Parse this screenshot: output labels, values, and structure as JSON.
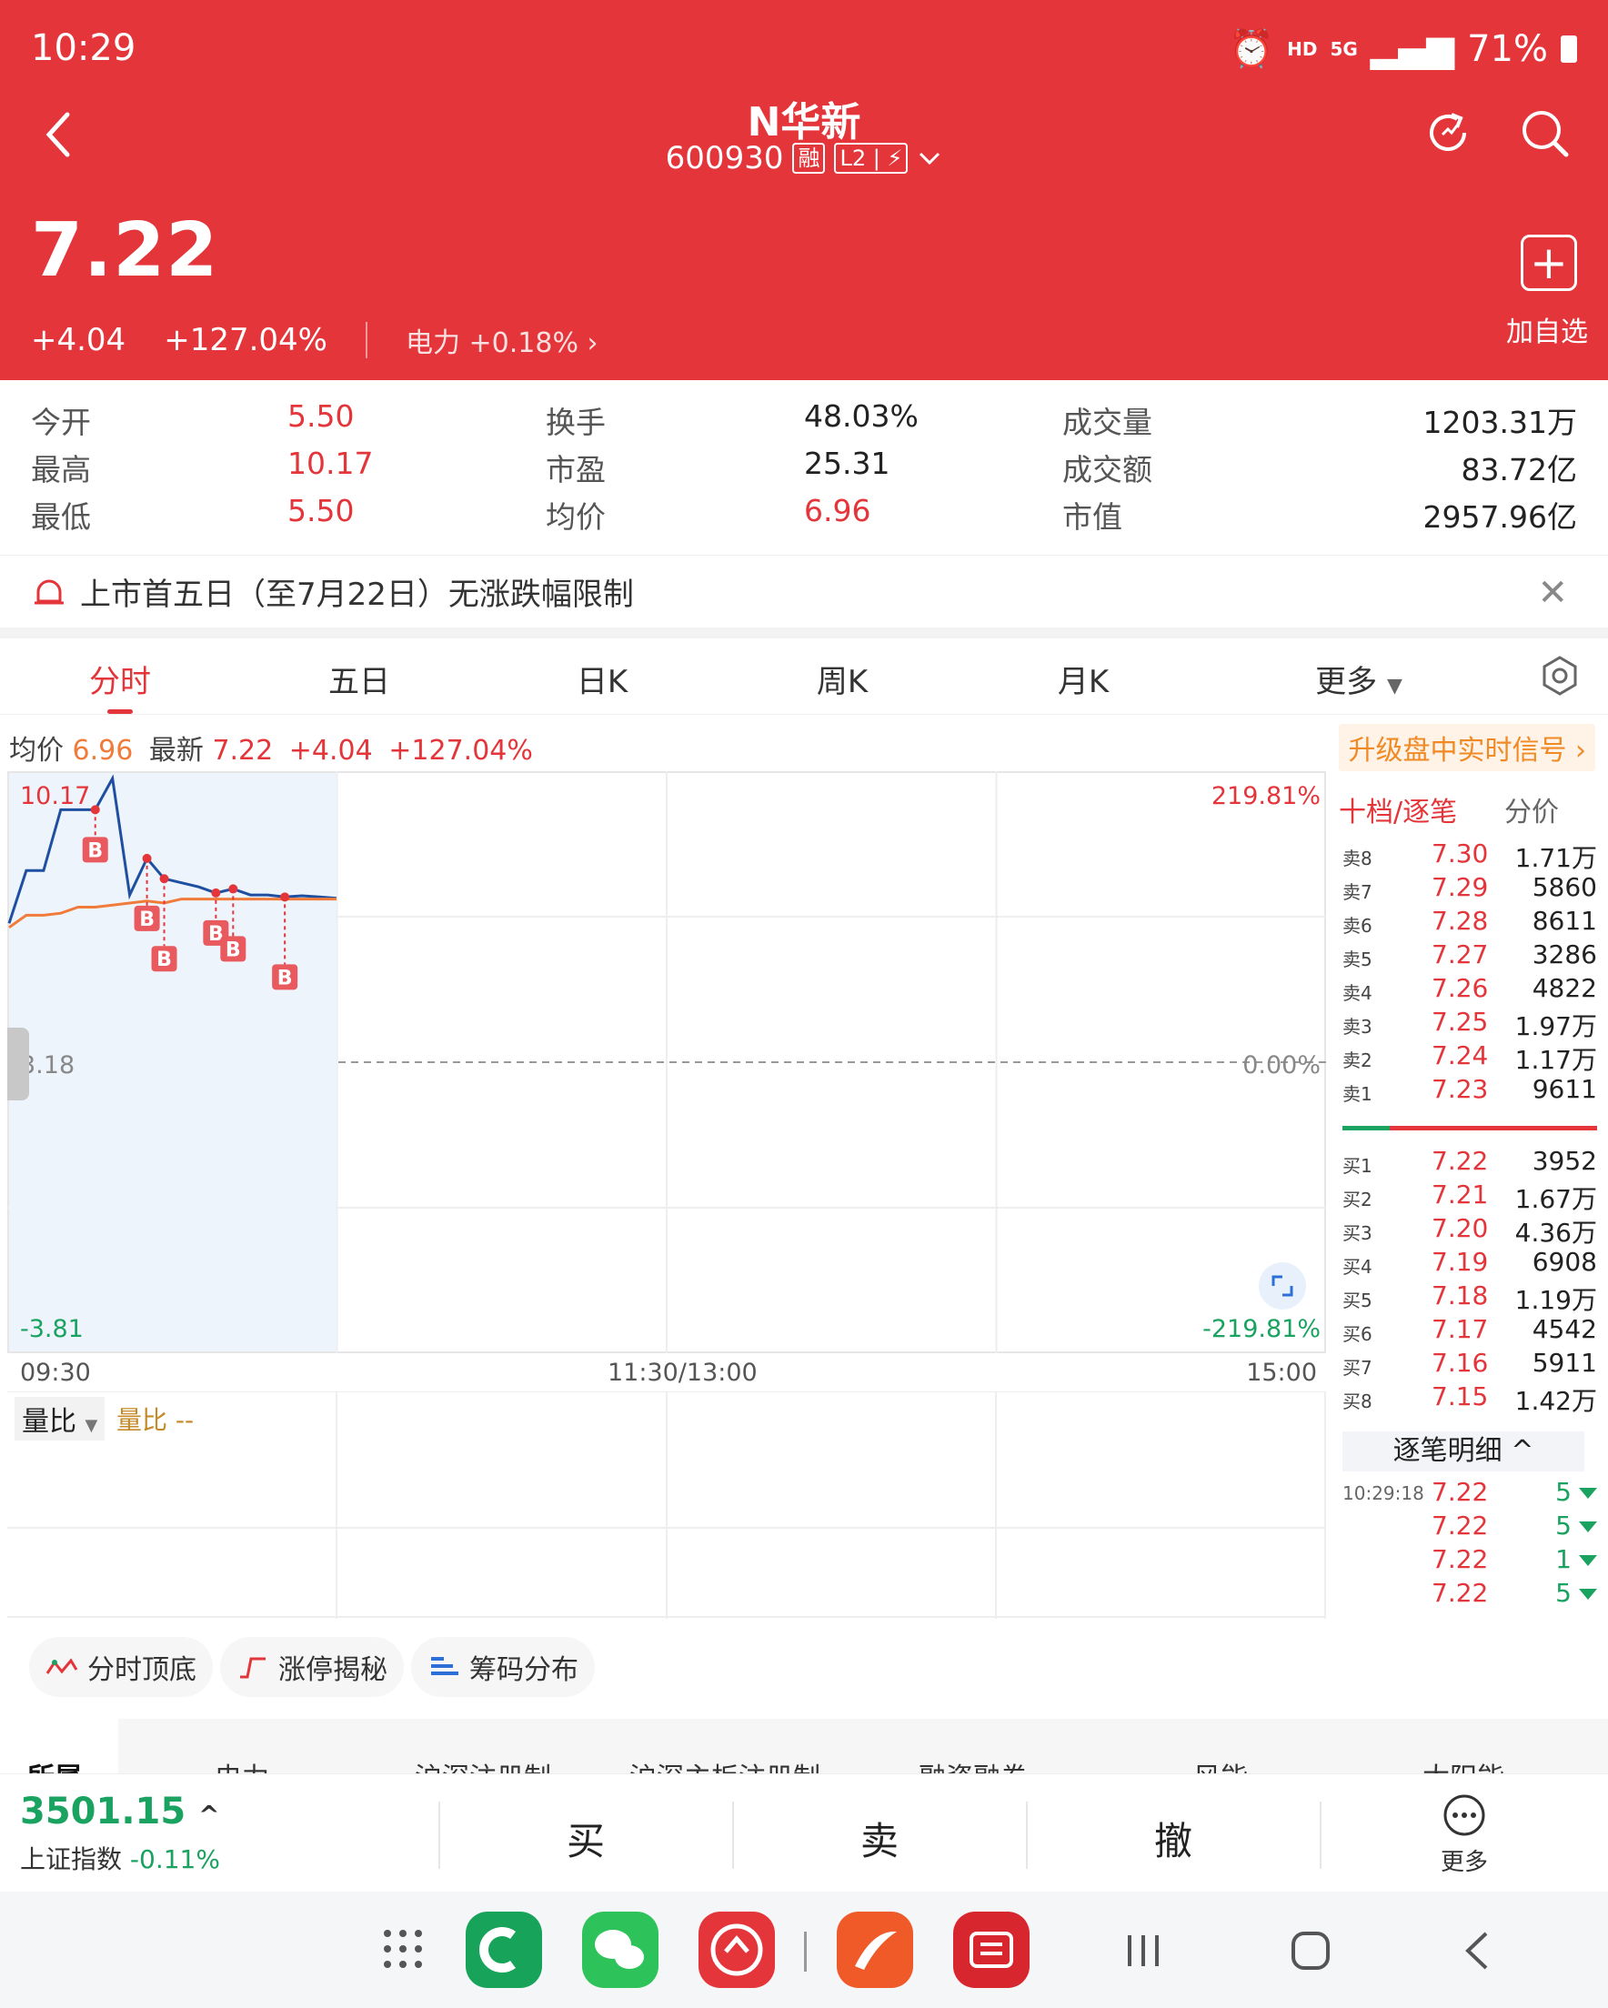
{
  "status_bar": {
    "time": "10:29",
    "hd": "HD",
    "net": "5G",
    "battery": "71%"
  },
  "header": {
    "back_icon": "chevron-left-icon",
    "title": "N华新",
    "code": "600930",
    "margin_tag": "融",
    "level_tag": "L2",
    "dropdown_icon": "chevron-down-icon",
    "refresh_icon": "refresh-icon",
    "search_icon": "search-icon",
    "price": "7.22",
    "change": "+4.04",
    "change_pct": "+127.04%",
    "sector": "电力 +0.18%",
    "add_label": "加自选"
  },
  "stats": {
    "open_label": "今开",
    "open": "5.50",
    "high_label": "最高",
    "high": "10.17",
    "low_label": "最低",
    "low": "5.50",
    "turnover_label": "换手",
    "turnover": "48.03%",
    "pe_label": "市盈",
    "pe": "25.31",
    "avg_label": "均价",
    "avg": "6.96",
    "vol_label": "成交量",
    "vol": "1203.31万",
    "amt_label": "成交额",
    "amt": "83.72亿",
    "mcap_label": "市值",
    "mcap": "2957.96亿"
  },
  "notice": {
    "text": "上市首五日（至7月22日）无涨跌幅限制",
    "close": "✕"
  },
  "tabs": [
    "分时",
    "五日",
    "日K",
    "周K",
    "月K",
    "更多"
  ],
  "chart_info": {
    "avg_label": "均价",
    "avg": "6.96",
    "latest_label": "最新",
    "latest": "7.22",
    "chg": "+4.04",
    "pct": "+127.04%",
    "upgrade": "升级盘中实时信号 ›"
  },
  "chart_data": {
    "type": "line",
    "y_top_label": "10.17",
    "y_mid_label": "3.18",
    "y_bottom_label": "-3.81",
    "pct_top": "219.81%",
    "pct_mid": "0.00%",
    "pct_bottom": "-219.81%",
    "x_labels": [
      "09:30",
      "11:30/13:00",
      "15:00"
    ],
    "ylim": [
      -3.81,
      10.17
    ],
    "series": [
      {
        "color": "#1f4fa0",
        "values": [
          6.6,
          7.9,
          7.9,
          9.4,
          9.4,
          9.4,
          10.17,
          7.3,
          8.2,
          7.7,
          7.6,
          7.5,
          7.35,
          7.45,
          7.3,
          7.3,
          7.25,
          7.28,
          7.25,
          7.22
        ]
      },
      {
        "color": "#f07b3a",
        "values": [
          6.5,
          6.8,
          6.8,
          6.85,
          7.0,
          7.0,
          7.05,
          7.1,
          7.15,
          7.1,
          7.2,
          7.2,
          7.2,
          7.2,
          7.2,
          7.2,
          7.2,
          7.2,
          7.2,
          7.2
        ]
      }
    ],
    "markers": [
      {
        "i": 5,
        "label": "B"
      },
      {
        "i": 8,
        "label": "B"
      },
      {
        "i": 9,
        "label": "B"
      },
      {
        "i": 12,
        "label": "B"
      },
      {
        "i": 13,
        "label": "B"
      },
      {
        "i": 16,
        "label": "B"
      }
    ],
    "volume_label": "量比",
    "volume_value": "量比 --"
  },
  "orderbook": {
    "header": "十档/逐笔",
    "header2": "分价",
    "asks": [
      {
        "lv": "卖8",
        "p": "7.30",
        "v": "1.71万"
      },
      {
        "lv": "卖7",
        "p": "7.29",
        "v": "5860"
      },
      {
        "lv": "卖6",
        "p": "7.28",
        "v": "8611"
      },
      {
        "lv": "卖5",
        "p": "7.27",
        "v": "3286"
      },
      {
        "lv": "卖4",
        "p": "7.26",
        "v": "4822"
      },
      {
        "lv": "卖3",
        "p": "7.25",
        "v": "1.97万"
      },
      {
        "lv": "卖2",
        "p": "7.24",
        "v": "1.17万"
      },
      {
        "lv": "卖1",
        "p": "7.23",
        "v": "9611"
      }
    ],
    "bids": [
      {
        "lv": "买1",
        "p": "7.22",
        "v": "3952"
      },
      {
        "lv": "买2",
        "p": "7.21",
        "v": "1.67万"
      },
      {
        "lv": "买3",
        "p": "7.20",
        "v": "4.36万"
      },
      {
        "lv": "买4",
        "p": "7.19",
        "v": "6908"
      },
      {
        "lv": "买5",
        "p": "7.18",
        "v": "1.19万"
      },
      {
        "lv": "买6",
        "p": "7.17",
        "v": "4542"
      },
      {
        "lv": "买7",
        "p": "7.16",
        "v": "5911"
      },
      {
        "lv": "买8",
        "p": "7.15",
        "v": "1.42万"
      }
    ],
    "tick_header": "逐笔明细 ^",
    "ticks": [
      {
        "t": "10:29:18",
        "p": "7.22",
        "v": "5"
      },
      {
        "t": "",
        "p": "7.22",
        "v": "5"
      },
      {
        "t": "",
        "p": "7.22",
        "v": "1"
      },
      {
        "t": "",
        "p": "7.22",
        "v": "5"
      }
    ]
  },
  "tools": [
    "分时顶底",
    "涨停揭秘",
    "筹码分布"
  ],
  "concepts": [
    "所属",
    "电力",
    "沪深注册制",
    "沪深主板注册制",
    "融资融券",
    "风能",
    "太阳能"
  ],
  "bottom": {
    "index": "3501.15",
    "index_name": "上证指数",
    "index_chg": "-0.11%",
    "buy": "买",
    "sell": "卖",
    "cancel": "撤",
    "more": "更多"
  }
}
